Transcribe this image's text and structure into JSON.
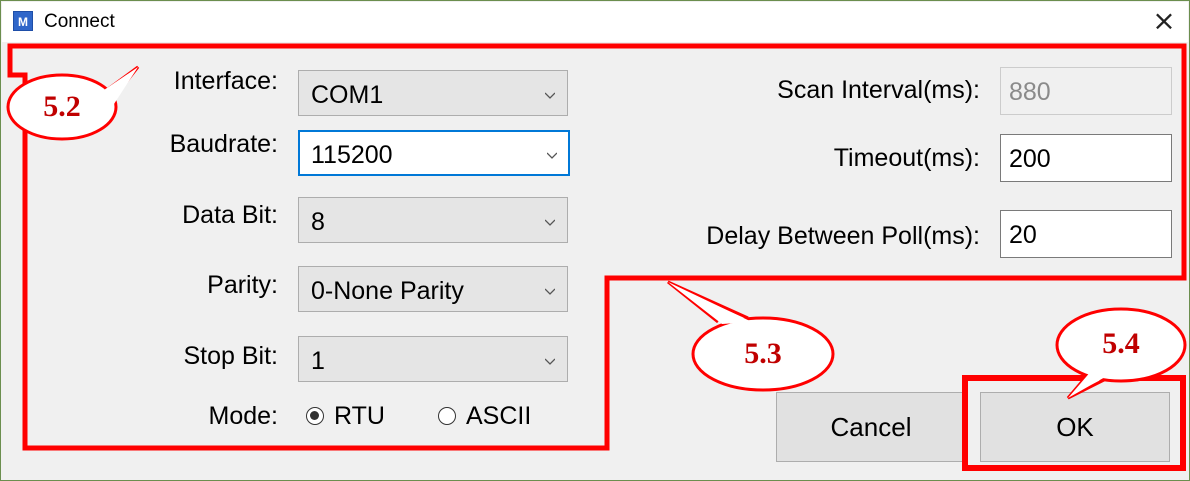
{
  "window": {
    "title": "Connect",
    "app_icon_letter": "M",
    "close_glyph": "×"
  },
  "serial": {
    "interface": {
      "label": "Interface:",
      "value": "COM1"
    },
    "baudrate": {
      "label": "Baudrate:",
      "value": "115200"
    },
    "data_bit": {
      "label": "Data Bit:",
      "value": "8"
    },
    "parity": {
      "label": "Parity:",
      "value": "0-None Parity"
    },
    "stop_bit": {
      "label": "Stop Bit:",
      "value": "1"
    },
    "mode": {
      "label": "Mode:",
      "options": [
        {
          "label": "RTU",
          "selected": true
        },
        {
          "label": "ASCII",
          "selected": false
        }
      ]
    }
  },
  "timing": {
    "scan_interval": {
      "label": "Scan Interval(ms):",
      "value": "880",
      "enabled": false
    },
    "timeout": {
      "label": "Timeout(ms):",
      "value": "200"
    },
    "delay_between_poll": {
      "label": "Delay Between Poll(ms):",
      "value": "20"
    }
  },
  "buttons": {
    "cancel": "Cancel",
    "ok": "OK"
  },
  "annotations": {
    "callout_5_2": "5.2",
    "callout_5_3": "5.3",
    "callout_5_4": "5.4",
    "highlight_color": "#ff0000",
    "callout_text_color": "#c00000"
  },
  "colors": {
    "focus_border": "#0078d7",
    "window_bg": "#f0f0f0",
    "title_bg": "#ffffff"
  }
}
